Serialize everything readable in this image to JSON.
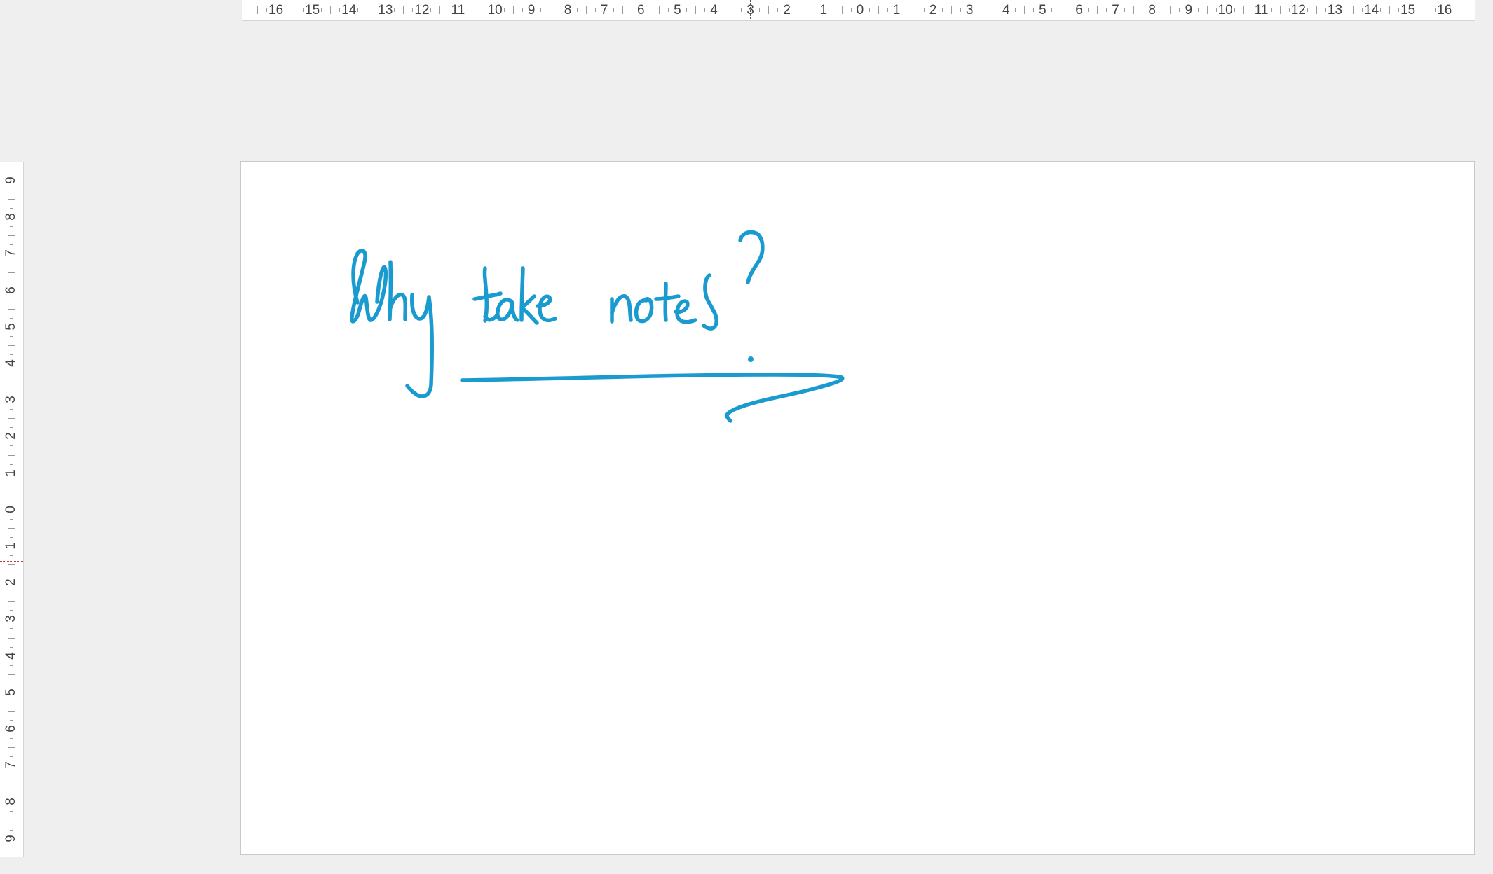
{
  "rulers": {
    "horizontal_labels": [
      "16",
      "15",
      "14",
      "13",
      "12",
      "11",
      "10",
      "9",
      "8",
      "7",
      "6",
      "5",
      "4",
      "3",
      "2",
      "1",
      "0",
      "1",
      "2",
      "3",
      "4",
      "5",
      "6",
      "7",
      "8",
      "9",
      "10",
      "11",
      "12",
      "13",
      "14",
      "15",
      "16"
    ],
    "vertical_labels": [
      "9",
      "8",
      "7",
      "6",
      "5",
      "4",
      "3",
      "2",
      "1",
      "0",
      "1",
      "2",
      "3",
      "4",
      "5",
      "6",
      "7",
      "8",
      "9"
    ]
  },
  "slide": {
    "ink_text": "Why take notes?",
    "ink_color": "#1a9bd0",
    "background": "#ffffff"
  },
  "colors": {
    "workspace": "#efefef",
    "ruler": "#ffffff"
  }
}
